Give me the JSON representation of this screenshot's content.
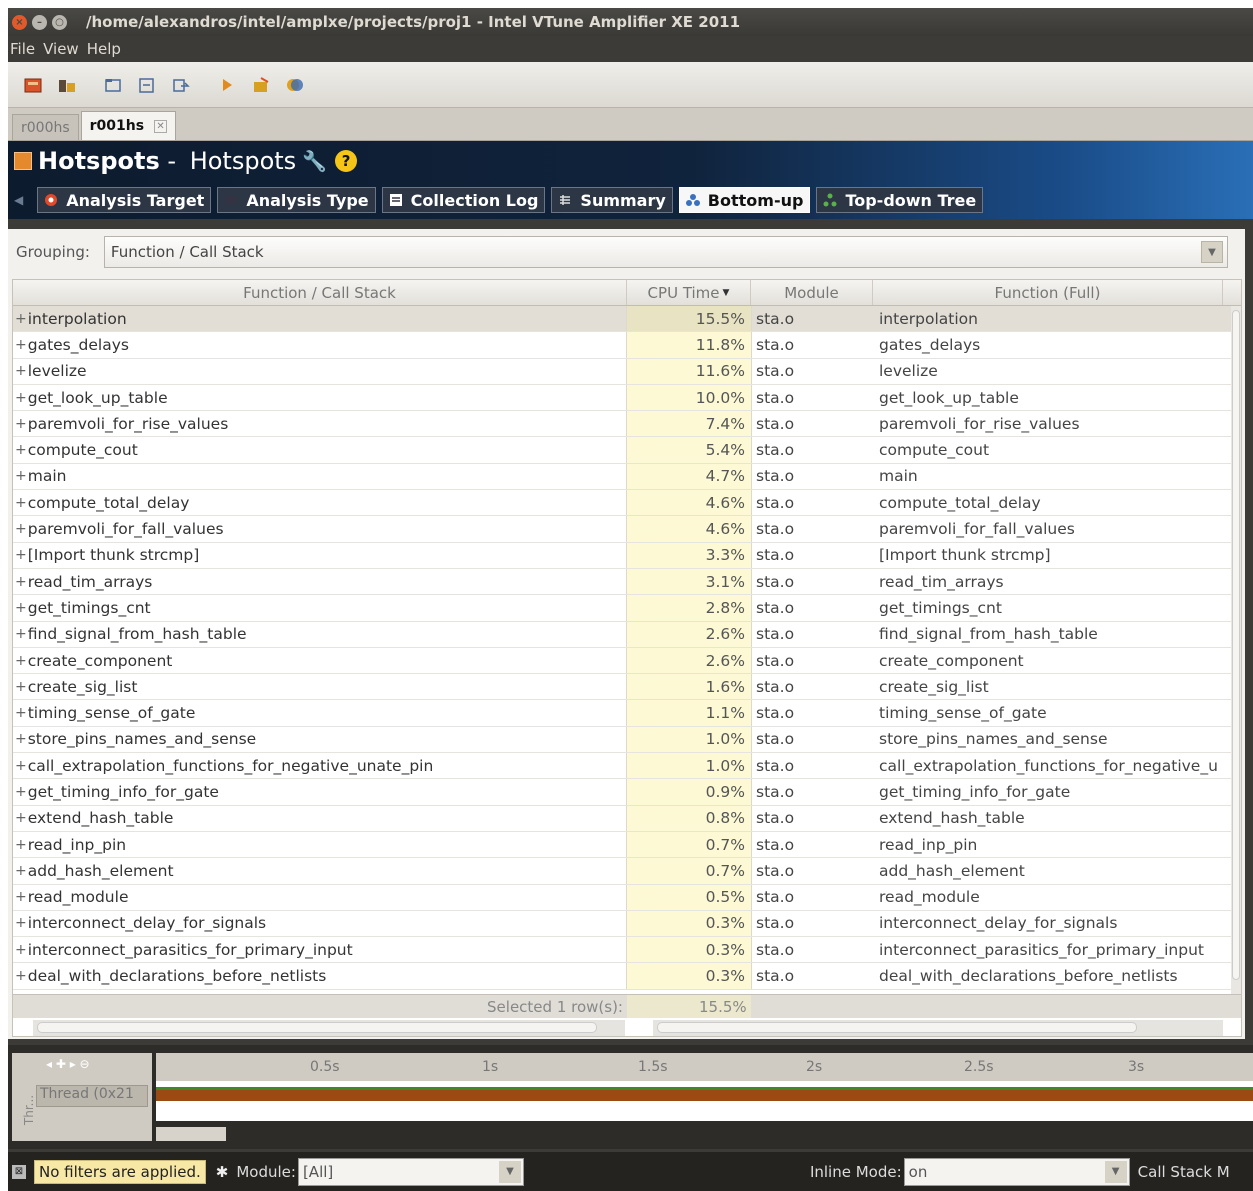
{
  "window": {
    "title": "/home/alexandros/intel/amplxe/projects/proj1 - Intel VTune Amplifier XE 2011"
  },
  "menu": [
    "File",
    "View",
    "Help"
  ],
  "result_tabs": [
    {
      "label": "r000hs",
      "active": false
    },
    {
      "label": "r001hs",
      "active": true
    }
  ],
  "header": {
    "title_main": "Hotspots",
    "title_sep": " - ",
    "title_sub": "Hotspots"
  },
  "nav_tabs": [
    {
      "label": "Analysis Target",
      "icon": "target-icon",
      "active": false
    },
    {
      "label": "Analysis Type",
      "icon": "analysis-type-icon",
      "active": false
    },
    {
      "label": "Collection Log",
      "icon": "log-icon",
      "active": false
    },
    {
      "label": "Summary",
      "icon": "summary-icon",
      "active": false
    },
    {
      "label": "Bottom-up",
      "icon": "bottom-up-icon",
      "active": true
    },
    {
      "label": "Top-down Tree",
      "icon": "tree-icon",
      "active": false
    }
  ],
  "grouping": {
    "label": "Grouping:",
    "value": "Function / Call Stack"
  },
  "table": {
    "columns": [
      "Function / Call Stack",
      "CPU Time",
      "Module",
      "Function (Full)"
    ],
    "rows": [
      {
        "func": "interpolation",
        "cpu": "15.5%",
        "module": "sta.o",
        "full": "interpolation"
      },
      {
        "func": "gates_delays",
        "cpu": "11.8%",
        "module": "sta.o",
        "full": "gates_delays"
      },
      {
        "func": "levelize",
        "cpu": "11.6%",
        "module": "sta.o",
        "full": "levelize"
      },
      {
        "func": "get_look_up_table",
        "cpu": "10.0%",
        "module": "sta.o",
        "full": "get_look_up_table"
      },
      {
        "func": "paremvoli_for_rise_values",
        "cpu": "7.4%",
        "module": "sta.o",
        "full": "paremvoli_for_rise_values"
      },
      {
        "func": "compute_cout",
        "cpu": "5.4%",
        "module": "sta.o",
        "full": "compute_cout"
      },
      {
        "func": "main",
        "cpu": "4.7%",
        "module": "sta.o",
        "full": "main"
      },
      {
        "func": "compute_total_delay",
        "cpu": "4.6%",
        "module": "sta.o",
        "full": "compute_total_delay"
      },
      {
        "func": "paremvoli_for_fall_values",
        "cpu": "4.6%",
        "module": "sta.o",
        "full": "paremvoli_for_fall_values"
      },
      {
        "func": "[Import thunk strcmp]",
        "cpu": "3.3%",
        "module": "sta.o",
        "full": "[Import thunk strcmp]"
      },
      {
        "func": "read_tim_arrays",
        "cpu": "3.1%",
        "module": "sta.o",
        "full": "read_tim_arrays"
      },
      {
        "func": "get_timings_cnt",
        "cpu": "2.8%",
        "module": "sta.o",
        "full": "get_timings_cnt"
      },
      {
        "func": "find_signal_from_hash_table",
        "cpu": "2.6%",
        "module": "sta.o",
        "full": "find_signal_from_hash_table"
      },
      {
        "func": "create_component",
        "cpu": "2.6%",
        "module": "sta.o",
        "full": "create_component"
      },
      {
        "func": "create_sig_list",
        "cpu": "1.6%",
        "module": "sta.o",
        "full": "create_sig_list"
      },
      {
        "func": "timing_sense_of_gate",
        "cpu": "1.1%",
        "module": "sta.o",
        "full": "timing_sense_of_gate"
      },
      {
        "func": "store_pins_names_and_sense",
        "cpu": "1.0%",
        "module": "sta.o",
        "full": "store_pins_names_and_sense"
      },
      {
        "func": "call_extrapolation_functions_for_negative_unate_pin",
        "cpu": "1.0%",
        "module": "sta.o",
        "full": "call_extrapolation_functions_for_negative_u"
      },
      {
        "func": "get_timing_info_for_gate",
        "cpu": "0.9%",
        "module": "sta.o",
        "full": "get_timing_info_for_gate"
      },
      {
        "func": "extend_hash_table",
        "cpu": "0.8%",
        "module": "sta.o",
        "full": "extend_hash_table"
      },
      {
        "func": "read_inp_pin",
        "cpu": "0.7%",
        "module": "sta.o",
        "full": "read_inp_pin"
      },
      {
        "func": "add_hash_element",
        "cpu": "0.7%",
        "module": "sta.o",
        "full": "add_hash_element"
      },
      {
        "func": "read_module",
        "cpu": "0.5%",
        "module": "sta.o",
        "full": "read_module"
      },
      {
        "func": "interconnect_delay_for_signals",
        "cpu": "0.3%",
        "module": "sta.o",
        "full": "interconnect_delay_for_signals"
      },
      {
        "func": "interconnect_parasitics_for_primary_input",
        "cpu": "0.3%",
        "module": "sta.o",
        "full": "interconnect_parasitics_for_primary_input"
      },
      {
        "func": "deal_with_declarations_before_netlists",
        "cpu": "0.3%",
        "module": "sta.o",
        "full": "deal_with_declarations_before_netlists"
      }
    ],
    "footer_label": "Selected 1 row(s):",
    "footer_value": "15.5%"
  },
  "timeline": {
    "ticks": [
      "0.5s",
      "1s",
      "1.5s",
      "2s",
      "2.5s",
      "3s"
    ],
    "thread_label": "Thread (0x21",
    "vertical_label": "Thr..."
  },
  "status": {
    "filter_text": "No filters are applied.",
    "module_label": "Module:",
    "module_value": "[All]",
    "inline_label": "Inline Mode:",
    "inline_value": "on",
    "callstack_label": "Call Stack M"
  },
  "colors": {
    "header_dark": "#0d1b2e",
    "header_blue": "#2a6fb7",
    "cpu_column": "#fcf9d4",
    "timeline_bar": "#9a4a12"
  }
}
